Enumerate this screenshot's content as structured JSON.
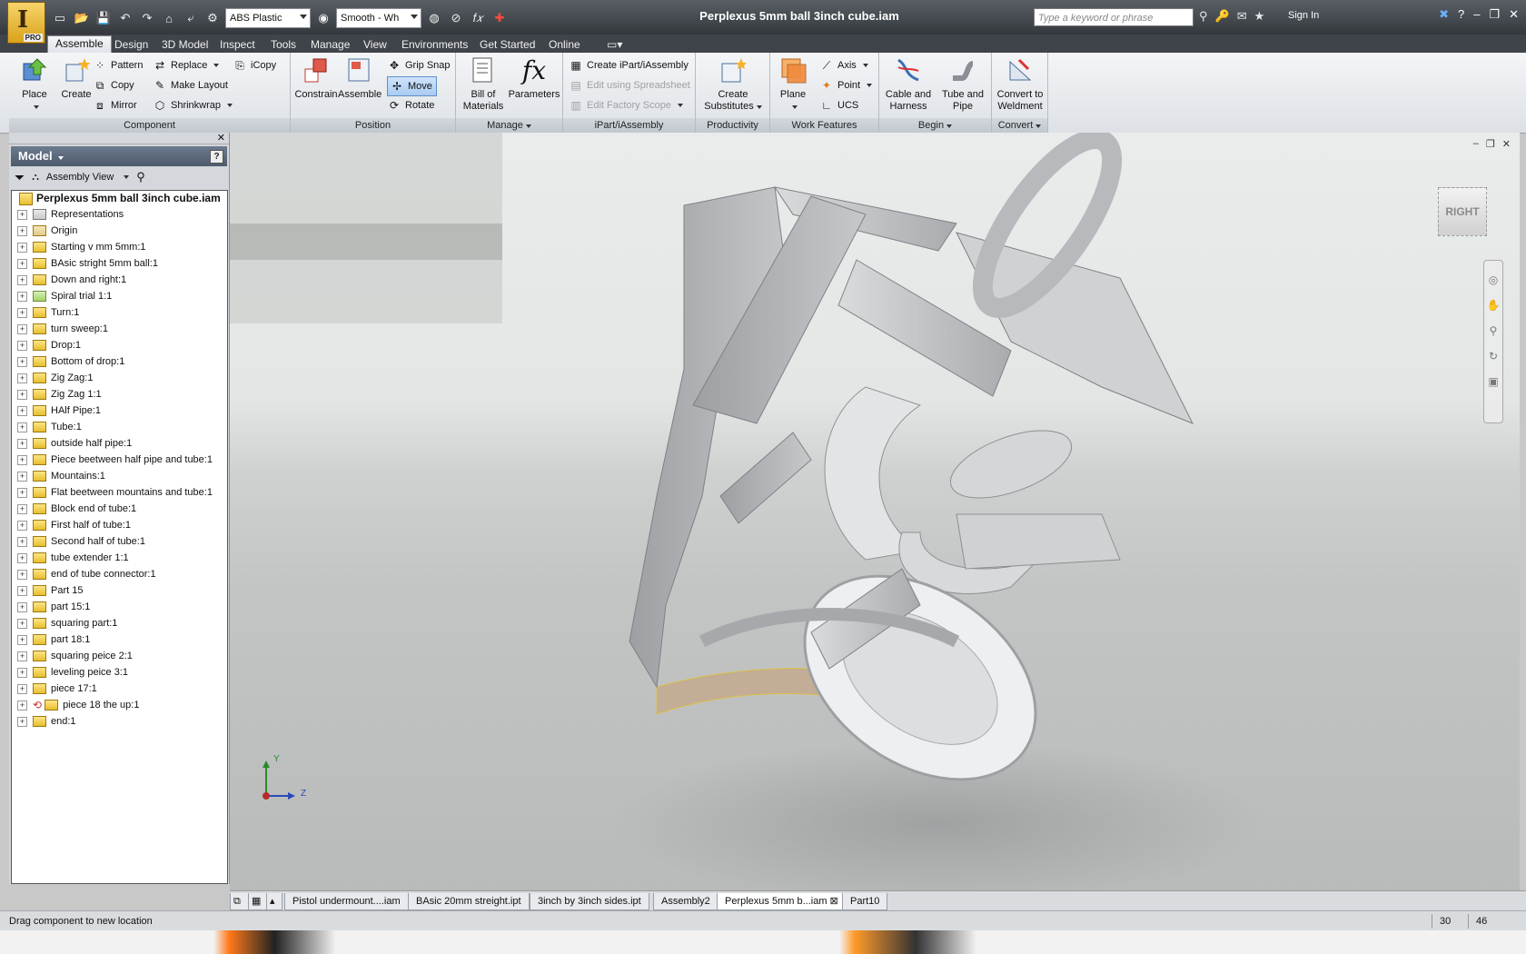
{
  "titlebar": {
    "title": "Perplexus 5mm ball 3inch cube.iam",
    "logo_badge": "PRO",
    "material_combo": "ABS Plastic",
    "visual_style_combo": "Smooth - Wh",
    "search_placeholder": "Type a keyword or phrase",
    "sign_in": "Sign In"
  },
  "tabs": [
    "Assemble",
    "Design",
    "3D Model",
    "Inspect",
    "Tools",
    "Manage",
    "View",
    "Environments",
    "Get Started",
    "Online"
  ],
  "ribbon": {
    "component": {
      "title": "Component",
      "place": "Place",
      "create": "Create",
      "pattern": "Pattern",
      "copy": "Copy",
      "mirror": "Mirror",
      "replace": "Replace",
      "make_layout": "Make Layout",
      "shrinkwrap": "Shrinkwrap",
      "icopy": "iCopy"
    },
    "position": {
      "title": "Position",
      "constrain": "Constrain",
      "assemble": "Assemble",
      "grip_snap": "Grip Snap",
      "move": "Move",
      "rotate": "Rotate"
    },
    "manage": {
      "title": "Manage",
      "bom_line1": "Bill of",
      "bom_line2": "Materials",
      "parameters": "Parameters"
    },
    "ipart": {
      "title": "iPart/iAssembly",
      "create": "Create iPart/iAssembly",
      "edit_spreadsheet": "Edit using Spreadsheet",
      "edit_factory": "Edit Factory Scope"
    },
    "productivity": {
      "title": "Productivity",
      "line1": "Create",
      "line2": "Substitutes"
    },
    "work_features": {
      "title": "Work Features",
      "plane": "Plane",
      "axis": "Axis",
      "point": "Point",
      "ucs": "UCS"
    },
    "begin": {
      "title": "Begin",
      "cable_line1": "Cable and",
      "cable_line2": "Harness",
      "tube_line1": "Tube and",
      "tube_line2": "Pipe"
    },
    "convert": {
      "title": "Convert",
      "line1": "Convert to",
      "line2": "Weldment"
    }
  },
  "browser": {
    "header": "Model",
    "view_combo": "Assembly View",
    "root": "Perplexus 5mm ball 3inch cube.iam",
    "items": [
      "Representations",
      "Origin",
      "Starting v mm 5mm:1",
      "BAsic stright 5mm ball:1",
      "Down and right:1",
      "Spiral trial 1:1",
      "Turn:1",
      "turn sweep:1",
      "Drop:1",
      "Bottom of drop:1",
      "Zig Zag:1",
      "Zig Zag 1:1",
      "HAlf Pipe:1",
      "Tube:1",
      "outside half pipe:1",
      "Piece beetween half pipe and tube:1",
      "Mountains:1",
      "Flat beetween mountains and tube:1",
      "Block end of tube:1",
      "First half of tube:1",
      "Second half of tube:1",
      "tube extender 1:1",
      "end of tube connector:1",
      "Part 15",
      "part 15:1",
      "squaring part:1",
      "part 18:1",
      "squaring peice 2:1",
      "leveling peice 3:1",
      "piece 17:1",
      "piece 18 the up:1",
      "end:1"
    ]
  },
  "viewport": {
    "viewcube_label": "RIGHT",
    "axis_y": "Y",
    "axis_z": "Z"
  },
  "doc_tabs": [
    "Pistol undermount....iam",
    "BAsic 20mm streight.ipt",
    "3inch by 3inch sides.ipt",
    "Assembly2",
    "Perplexus 5mm b...iam",
    "Part10"
  ],
  "status": {
    "message": "Drag component to new location",
    "num1": "30",
    "num2": "46"
  }
}
